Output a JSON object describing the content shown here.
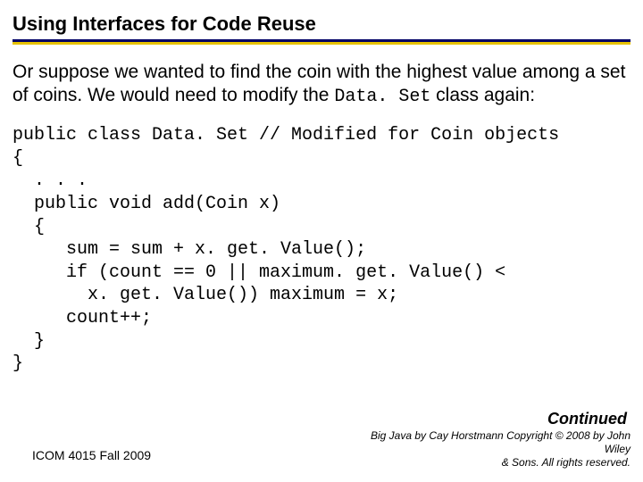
{
  "title": "Using Interfaces for Code Reuse",
  "paragraph": {
    "part1": "Or suppose we wanted to find the coin with the highest value among a set of coins. We would need to modify the ",
    "code_inline": "Data. Set",
    "part2": " class again:"
  },
  "code": "public class Data. Set // Modified for Coin objects\n{\n  . . .\n  public void add(Coin x)\n  {\n     sum = sum + x. get. Value();\n     if (count == 0 || maximum. get. Value() <\n       x. get. Value()) maximum = x;\n     count++;\n  }\n}",
  "continued": "Continued",
  "footer_left": "ICOM 4015 Fall 2009",
  "footer_right_line1": "Big Java by Cay Horstmann Copyright © 2008 by John Wiley",
  "footer_right_line2": "& Sons. All rights reserved."
}
